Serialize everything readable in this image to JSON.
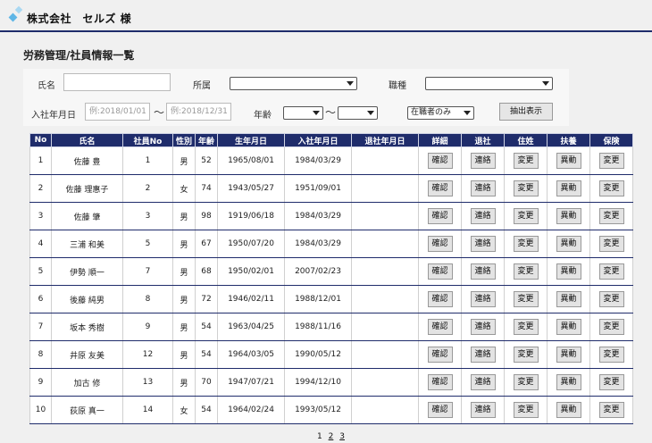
{
  "header": {
    "company": "株式会社　セルズ 様"
  },
  "page": {
    "title": "労務管理/社員情報一覧"
  },
  "search": {
    "name_label": "氏名",
    "name_value": "",
    "dept_label": "所属",
    "dept_value": "",
    "job_label": "職種",
    "job_value": "",
    "hire_label": "入社年月日",
    "hire_from_placeholder": "例:2018/01/01",
    "hire_to_placeholder": "例:2018/12/31",
    "tilde": "〜",
    "age_label": "年齢",
    "age_from": "",
    "age_to": "",
    "status_value": "在職者のみ",
    "submit_label": "抽出表示"
  },
  "table": {
    "headers": [
      "No",
      "氏名",
      "社員No",
      "性別",
      "年齢",
      "生年月日",
      "入社年月日",
      "退社年月日",
      "詳細",
      "退社",
      "住姓",
      "扶養",
      "保険"
    ],
    "action_labels": {
      "detail": "確認",
      "leave": "連絡",
      "address": "変更",
      "dependent": "異動",
      "insurance": "変更"
    },
    "rows": [
      {
        "no": "1",
        "name": "佐藤 豊",
        "emp_no": "1",
        "gender": "男",
        "age": "52",
        "birth": "1965/08/01",
        "hire": "1984/03/29",
        "leave": ""
      },
      {
        "no": "2",
        "name": "佐藤 理惠子",
        "emp_no": "2",
        "gender": "女",
        "age": "74",
        "birth": "1943/05/27",
        "hire": "1951/09/01",
        "leave": ""
      },
      {
        "no": "3",
        "name": "佐藤 肇",
        "emp_no": "3",
        "gender": "男",
        "age": "98",
        "birth": "1919/06/18",
        "hire": "1984/03/29",
        "leave": ""
      },
      {
        "no": "4",
        "name": "三浦 和美",
        "emp_no": "5",
        "gender": "男",
        "age": "67",
        "birth": "1950/07/20",
        "hire": "1984/03/29",
        "leave": ""
      },
      {
        "no": "5",
        "name": "伊勢 順一",
        "emp_no": "7",
        "gender": "男",
        "age": "68",
        "birth": "1950/02/01",
        "hire": "2007/02/23",
        "leave": ""
      },
      {
        "no": "6",
        "name": "後藤 純男",
        "emp_no": "8",
        "gender": "男",
        "age": "72",
        "birth": "1946/02/11",
        "hire": "1988/12/01",
        "leave": ""
      },
      {
        "no": "7",
        "name": "坂本 秀樹",
        "emp_no": "9",
        "gender": "男",
        "age": "54",
        "birth": "1963/04/25",
        "hire": "1988/11/16",
        "leave": ""
      },
      {
        "no": "8",
        "name": "井原 友美",
        "emp_no": "12",
        "gender": "男",
        "age": "54",
        "birth": "1964/03/05",
        "hire": "1990/05/12",
        "leave": ""
      },
      {
        "no": "9",
        "name": "加古 修",
        "emp_no": "13",
        "gender": "男",
        "age": "70",
        "birth": "1947/07/21",
        "hire": "1994/12/10",
        "leave": ""
      },
      {
        "no": "10",
        "name": "荻原 真一",
        "emp_no": "14",
        "gender": "女",
        "age": "54",
        "birth": "1964/02/24",
        "hire": "1993/05/12",
        "leave": ""
      }
    ]
  },
  "pager": {
    "current": "1",
    "pages": [
      "2",
      "3"
    ]
  },
  "colors": {
    "primary": "#1f2c6b",
    "logo": "#5fb6e6"
  }
}
